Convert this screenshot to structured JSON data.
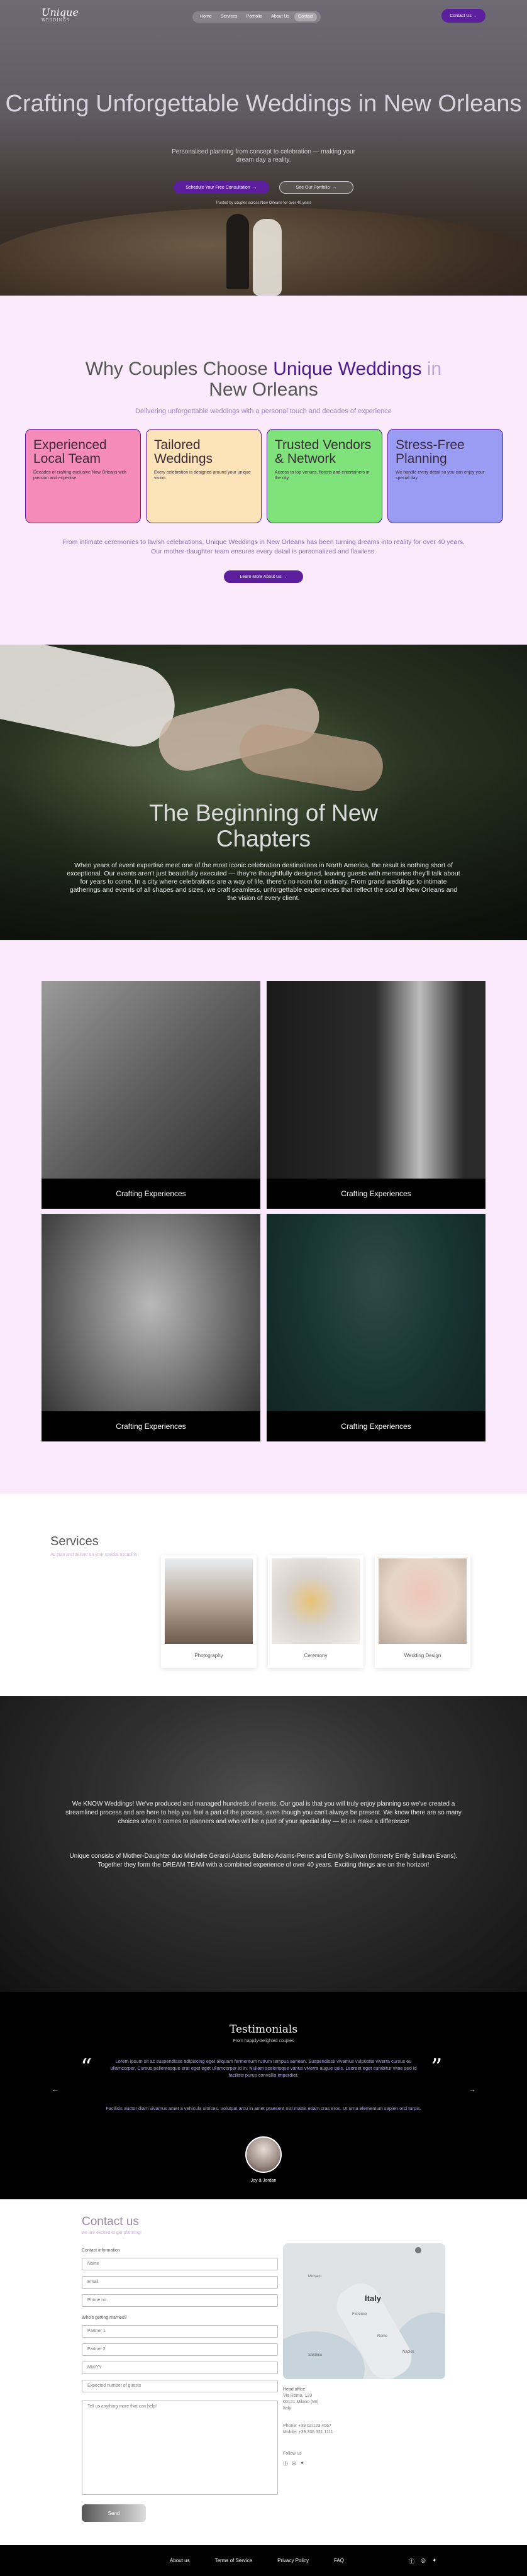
{
  "nav": {
    "logo": "Unique",
    "logo_sub": "WEDDINGS",
    "menu": [
      "Home",
      "Services",
      "Portfolio",
      "About Us",
      "Contact"
    ],
    "cta": "Contact Us"
  },
  "hero": {
    "title": "Crafting Unforgettable Weddings in New Orleans",
    "subtitle": "Personalised planning from concept to celebration — making your dream day a reality.",
    "primary_button": "Schedule Your Free Consultation",
    "secondary_button": "See Our Portfolio",
    "note": "Trusted by couples across New Orleans for over 40 years"
  },
  "why": {
    "title_a": "Why Couples Choose ",
    "title_accent": "Unique Weddings",
    "title_faint": " in",
    "title_b": "New Orleans",
    "lead": "Delivering unforgettable weddings with a personal touch and decades of experience",
    "cards": [
      {
        "title": "Experienced Local Team",
        "text": "Decades of crafting exclusive New Orleans with passion and expertise.",
        "color": "#f48bb8"
      },
      {
        "title": "Tailored Weddings",
        "text": "Every celebration is designed around your unique vision.",
        "color": "#fde3b8"
      },
      {
        "title": "Trusted Vendors & Network",
        "text": "Access to top venues, florists and entertainers in the city.",
        "color": "#7fe27a"
      },
      {
        "title": "Stress-Free Planning",
        "text": "We handle every detail so you can enjoy your special day.",
        "color": "#9a9cf4"
      }
    ],
    "body": "From intimate ceremonies to lavish celebrations, Unique Weddings in New Orleans has been turning dreams into reality for over 40 years. Our mother-daughter team ensures every detail is personalized and flawless.",
    "button": "Learn More About Us"
  },
  "beginning": {
    "title": "The  Beginning of New Chapters",
    "text": "When years of event expertise meet one of the most iconic celebration destinations in North America, the result is nothing short of exceptional. Our events aren't just beautifully executed — they're thoughtfully designed, leaving guests with memories they'll talk about for years to come. In a city where celebrations are a way of life, there's no room for ordinary. From grand weddings to intimate gatherings and events of all shapes and sizes, we craft seamless, unforgettable experiences that reflect the soul of New Orleans and the vision of every client."
  },
  "experiences": [
    "Crafting Experiences",
    "Crafting Experiences",
    "Crafting Experiences",
    "Crafting Experiences"
  ],
  "services": {
    "title": "Services",
    "subtitle": "As plan and deliver on your special occasion",
    "items": [
      "Photography",
      "Ceremony",
      "Wedding Design"
    ]
  },
  "know": {
    "p1": "We KNOW Weddings! We've produced and managed hundreds of events. Our goal is that you will truly enjoy planning so we've created a streamlined process and are here to help you feel a part of the process, even though you can't always be present. We know there are so many choices when it comes to planners and who will be a part of your special day — let us make a difference!",
    "p2": "Unique consists of Mother-Daughter duo Michelle Gerardi Adams Bullerio Adams-Perret and Emily Sullivan (formerly Emily Sullivan Evans). Together they form the DREAM TEAM with a combined experience of over 40 years. Exciting things are on the horizon!"
  },
  "testimonials": {
    "title": "Testimonials",
    "subtitle": "From happily-delighted couples",
    "quote": "Lorem ipsum sit ac suspendisse adipiscing eget aliquam fermentum rutrum tempus aenean. Suspendisse vivamus vulputate viverra cursus eu ullamcorper. Cursus pellentesque erat eget eget ullamcorper id in. Nullam scelerisque varius viverra augue quis. Laoreet eget curabitur vitae sed id facilisis purus convallis imperdiet.",
    "quote2": "Facilisis auctor diam vivamus amet a vehicula ultrices. Volutpat arcu in amet praesent nisl mattis etiam cras eros. Ut urna elementum sapien orci turpis.",
    "name": "Joy & Jordan"
  },
  "contact": {
    "title": "Contact us",
    "subtitle": "we are excited to get planning!",
    "info_label": "Contact information",
    "name_ph": "Name",
    "email_ph": "Email",
    "phone_ph": "Phone no.",
    "who_label": "Who's getting married?",
    "partner1_ph": "Partner 1",
    "partner2_ph": "Partner 2",
    "date_ph": "MM/YY",
    "guests_ph": "Expected number of guests",
    "message_ph": "Tell us anything more that can help!",
    "send": "Send",
    "map_country": "Italy",
    "map_labels": [
      "Monaco",
      "Florence",
      "Rome",
      "Naples",
      "Sardinia"
    ],
    "office_title": "Head office",
    "address": "Via Roma, 123",
    "city": "00121 Milano (MI)",
    "country": "Italy",
    "phone": "Phone: +39 02/123 4567",
    "mobile": "Mobile: +39 338 321 1111",
    "follow": "Follow us"
  },
  "footer": {
    "links": [
      "About us",
      "Terms of Service",
      "Privacy Policy",
      "FAQ"
    ]
  }
}
